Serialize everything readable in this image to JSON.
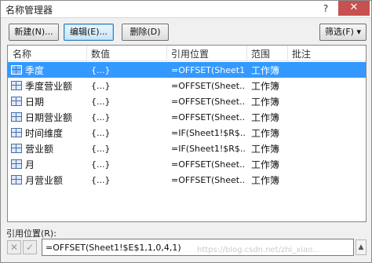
{
  "window": {
    "title": "名称管理器",
    "help_label": "?",
    "close_label": "✕"
  },
  "toolbar": {
    "new_label": "新建(N)...",
    "edit_label": "编辑(E)...",
    "delete_label": "删除(D)",
    "filter_label": "筛选(F) ▾"
  },
  "table": {
    "headers": [
      "名称",
      "数值",
      "引用位置",
      "范围",
      "批注"
    ],
    "rows": [
      {
        "name": "季度",
        "value": "{...}",
        "ref": "=OFFSET(Sheet1!...",
        "scope": "工作簿",
        "comment": ""
      },
      {
        "name": "季度营业额",
        "value": "{...}",
        "ref": "=OFFSET(Sheet...",
        "scope": "工作簿",
        "comment": ""
      },
      {
        "name": "日期",
        "value": "{...}",
        "ref": "=OFFSET(Sheet...",
        "scope": "工作簿",
        "comment": ""
      },
      {
        "name": "日期营业额",
        "value": "{...}",
        "ref": "=OFFSET(Sheet...",
        "scope": "工作簿",
        "comment": ""
      },
      {
        "name": "时间维度",
        "value": "{...}",
        "ref": "=IF(Sheet1!$R$...",
        "scope": "工作簿",
        "comment": ""
      },
      {
        "name": "营业额",
        "value": "{...}",
        "ref": "=IF(Sheet1!$R$...",
        "scope": "工作簿",
        "comment": ""
      },
      {
        "name": "月",
        "value": "{...}",
        "ref": "=OFFSET(Sheet...",
        "scope": "工作簿",
        "comment": ""
      },
      {
        "name": "月营业额",
        "value": "{...}",
        "ref": "=OFFSET(Sheet...",
        "scope": "工作簿",
        "comment": ""
      }
    ],
    "selected_index": 0
  },
  "reference": {
    "label": "引用位置(R):",
    "value": "=OFFSET(Sheet1!$E$1,1,0,4,1)",
    "cancel_glyph": "✕",
    "confirm_glyph": "✓",
    "collapse_glyph": "▲"
  },
  "watermark": "https://blog.csdn.net/zhi_xiao..."
}
